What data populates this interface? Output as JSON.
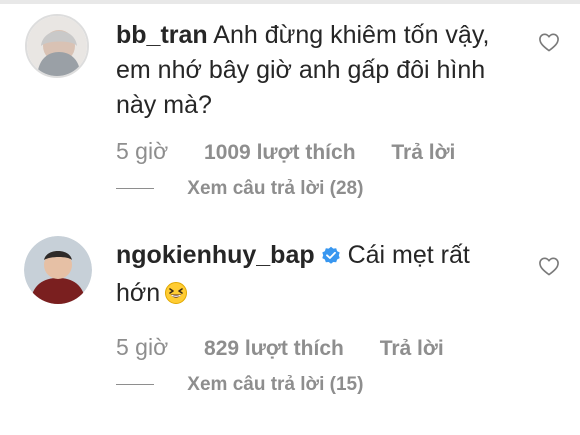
{
  "comments": [
    {
      "username": "bb_tran",
      "text": "Anh đừng khiêm tốn vậy, em nhớ bây giờ anh gấp đôi hình này mà?",
      "time": "5 giờ",
      "likes": "1009 lượt thích",
      "reply": "Trả lời",
      "view_replies": "Xem câu trả lời (28)"
    },
    {
      "username": "ngokienhuy_bap",
      "text": "Cái mẹt rất hớn",
      "time": "5 giờ",
      "likes": "829 lượt thích",
      "reply": "Trả lời",
      "view_replies": "Xem câu trả lời (15)",
      "verified": true,
      "emoji": "grinning-squinting-face"
    }
  ],
  "colors": {
    "text": "#262626",
    "muted": "#8e8e8e",
    "verified": "#3897f0"
  }
}
